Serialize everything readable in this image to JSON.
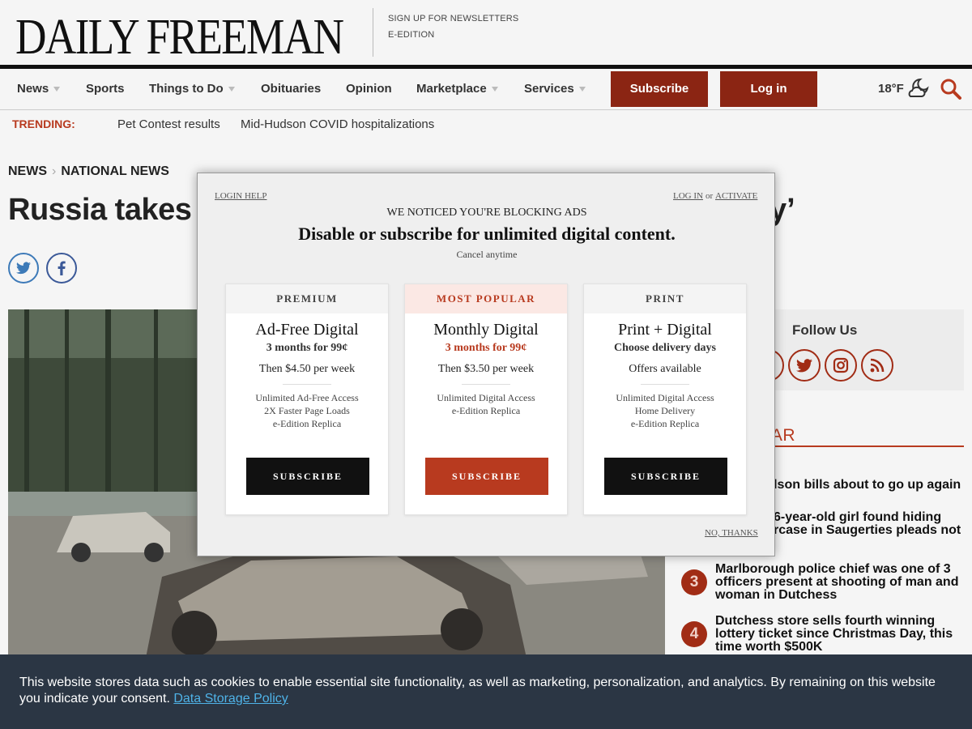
{
  "header": {
    "logo": "DAILY FREEMAN",
    "links": [
      "SIGN UP FOR NEWSLETTERS",
      "E-EDITION"
    ]
  },
  "nav": {
    "items": [
      "News",
      "Sports",
      "Things to Do",
      "Obituaries",
      "Opinion",
      "Marketplace",
      "Services"
    ],
    "subscribe": "Subscribe",
    "login": "Log in",
    "temperature": "18°F"
  },
  "trending": {
    "label": "TRENDING:",
    "links": [
      "Pet Contest results",
      "Mid-Hudson COVID hospitalizations"
    ]
  },
  "article": {
    "breadcrumb": [
      "NEWS",
      "NATIONAL NEWS"
    ],
    "headline_start": "Russia takes a",
    "headline_end": "y’"
  },
  "sidebar": {
    "follow_title": "Follow Us",
    "popular_title": "ULAR",
    "popular": [
      {
        "num": "",
        "text": "udson bills about to go up again"
      },
      {
        "num": "",
        "text": "6-year-old girl found hiding\nrcase in Saugerties pleads not"
      },
      {
        "num": "3",
        "text": "Marlborough police chief was one of 3 officers present at shooting of man and woman in Dutchess"
      },
      {
        "num": "4",
        "text": "Dutchess store sells fourth winning lottery ticket since Christmas Day, this time worth $500K"
      }
    ]
  },
  "modal": {
    "login_help": "LOGIN HELP",
    "log_in": "LOG IN",
    "or": "or",
    "activate": "ACTIVATE",
    "kicker": "WE NOTICED YOU'RE BLOCKING ADS",
    "title": "Disable or subscribe for unlimited digital content.",
    "cancel": "Cancel anytime",
    "no_thanks": "NO, THANKS",
    "plans": [
      {
        "tag": "PREMIUM",
        "name": "Ad-Free Digital",
        "offer": "3 months for 99¢",
        "then": "Then $4.50 per week",
        "features": [
          "Unlimited Ad-Free Access",
          "2X Faster Page Loads",
          "e-Edition Replica"
        ],
        "button": "SUBSCRIBE"
      },
      {
        "tag": "MOST POPULAR",
        "name": "Monthly Digital",
        "offer": "3 months for 99¢",
        "then": "Then $3.50 per week",
        "features": [
          "Unlimited Digital Access",
          "e-Edition Replica"
        ],
        "button": "SUBSCRIBE"
      },
      {
        "tag": "PRINT",
        "name": "Print + Digital",
        "offer": "Choose delivery days",
        "then": "Offers available",
        "features": [
          "Unlimited Digital Access",
          "Home Delivery",
          "e-Edition Replica"
        ],
        "button": "SUBSCRIBE"
      }
    ]
  },
  "cookie": {
    "text": "This website stores data such as cookies to enable essential site functionality, as well as marketing, personalization, and analytics. By remaining on this website you indicate your consent. ",
    "link": "Data Storage Policy"
  },
  "colors": {
    "brand_red": "#8b2513",
    "accent_red": "#b83a1f",
    "cookie_bg": "#2b3644",
    "cookie_link": "#4fb3e8"
  }
}
